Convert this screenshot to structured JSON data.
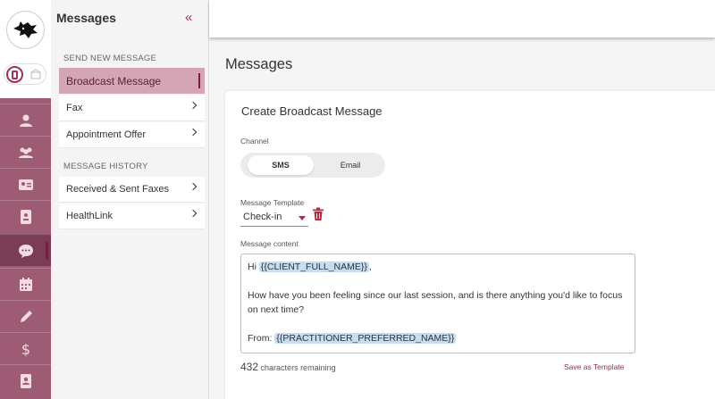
{
  "panel": {
    "title": "Messages",
    "collapse_icon": "double-chevron-left-icon",
    "send_section": "SEND NEW MESSAGE",
    "send_items": [
      {
        "label": "Broadcast Message",
        "selected": true
      },
      {
        "label": "Fax"
      },
      {
        "label": "Appointment Offer"
      }
    ],
    "history_section": "MESSAGE HISTORY",
    "history_items": [
      {
        "label": "Received & Sent Faxes"
      },
      {
        "label": "HealthLink"
      }
    ]
  },
  "rail": {
    "icons": [
      "person-icon",
      "group-icon",
      "id-card-icon",
      "contact-book-icon",
      "chat-icon",
      "calendar-icon",
      "pen-icon",
      "dollar-icon",
      "contacts-icon"
    ],
    "active": "chat-icon",
    "color": "#9d5c73"
  },
  "main": {
    "page_title": "Messages",
    "card_title": "Create Broadcast Message",
    "channel_label": "Channel",
    "channel_options": [
      "SMS",
      "Email"
    ],
    "channel_selected": "SMS",
    "template_label": "Message Template",
    "template_value": "Check-in",
    "content_label": "Message content",
    "message": {
      "greeting": "Hi",
      "token_client": "{{CLIENT_FULL_NAME}}",
      "comma": ",",
      "body": "How have you been feeling since our last session, and is there anything you'd like to focus on next time?",
      "from_label": "From:",
      "token_practitioner": "{{PRACTITIONER_PREFERRED_NAME}}"
    },
    "chars_remaining_count": "432",
    "chars_remaining_text": "characters remaining",
    "save_template_label": "Save as Template"
  }
}
